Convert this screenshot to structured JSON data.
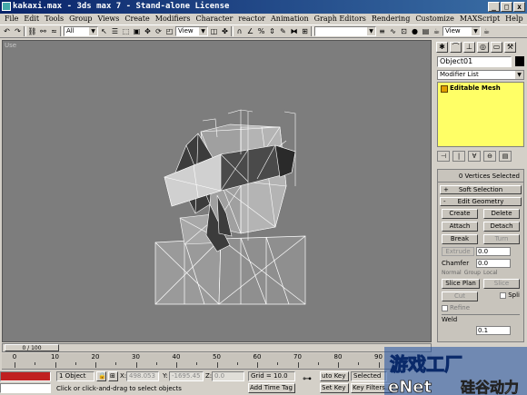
{
  "window": {
    "title": "kakaxi.max - 3ds max 7  - Stand-alone License",
    "min": "_",
    "max": "□",
    "close": "x"
  },
  "menu": [
    "File",
    "Edit",
    "Tools",
    "Group",
    "Views",
    "Create",
    "Modifiers",
    "Character",
    "reactor",
    "Animation",
    "Graph Editors",
    "Rendering",
    "Customize",
    "MAXScript",
    "Help"
  ],
  "toolbar": {
    "selection_filter": "All",
    "ref_coord": "View",
    "named_selection": "",
    "render_view": "View"
  },
  "viewport": {
    "label": "Use"
  },
  "command_panel": {
    "object_name": "Object01",
    "object_color": "#000000",
    "modifier_list": "Modifier List",
    "stack_item": "Editable Mesh",
    "stack_color": "#ffff66",
    "vertices_selected": "0 Vertices Selected",
    "rollout_soft": "Soft Selection",
    "rollout_edit": "Edit Geometry",
    "sign_plus": "+",
    "sign_minus": "-",
    "btn_create": "Create",
    "btn_delete": "Delete",
    "btn_attach": "Attach",
    "btn_detach": "Detach",
    "btn_break": "Break",
    "btn_turn": "Turn",
    "extrude_label": "Extrude",
    "extrude_value": "0.0",
    "chamfer_label": "Chamfer",
    "chamfer_value": "0.0",
    "radio_normal": "Normal",
    "radio_group": "Group",
    "radio_local": "Local",
    "btn_slice_plane": "Slice Plan",
    "btn_slice": "Slice",
    "btn_cut": "Cut",
    "split_label": "Spli",
    "refine_label": "Refine",
    "weld_label": "Weld",
    "weld_value": "0.1"
  },
  "timeline": {
    "slider_label": "0 / 100",
    "ticks": [
      "0",
      "10",
      "20",
      "30",
      "40",
      "50",
      "60",
      "70",
      "80",
      "90"
    ]
  },
  "status": {
    "selection_count": "1 Object",
    "x_label": "X:",
    "x_value": "498.053",
    "y_label": "Y:",
    "y_value": "-1695.45",
    "z_label": "Z:",
    "z_value": "0.0",
    "grid": "Grid = 10.0",
    "auto_key": "uto Key",
    "selected_label": "Selected",
    "prompt": "Click or click-and-drag to select objects",
    "add_time_tag": "Add Time Tag",
    "set_key": "Set Key",
    "key_filters": "Key Filters..."
  },
  "watermark": {
    "text1": "游戏工厂",
    "brand": "eNet",
    "text2": "硅谷动力"
  },
  "colors": {
    "viewport_bg": "#7d7d7d",
    "accent_red": "#c02020",
    "title_blue": "#0a246a"
  }
}
